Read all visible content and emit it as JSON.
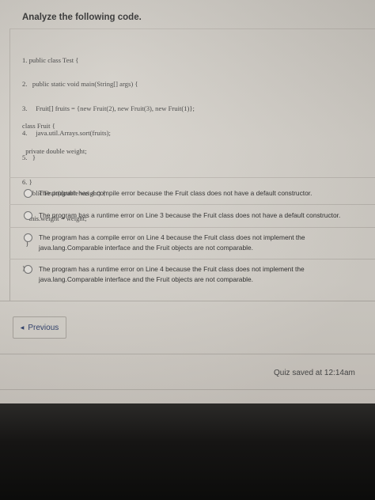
{
  "question": {
    "title": "Analyze the following code.",
    "code_main": [
      "1. public class Test {",
      "2.   public static void main(String[] args) {",
      "3.     Fruit[] fruits = {new Fruit(2), new Fruit(3), new Fruit(1)};",
      "4.     java.util.Arrays.sort(fruits);",
      "5.   }",
      "6. }"
    ],
    "code_class": [
      "class Fruit {",
      "  private double weight;",
      "",
      "  public Fruit(double weight) {",
      "    this.weight = weight;",
      "  }",
      "}"
    ]
  },
  "options": [
    "The program has a compile error because the Fruit class does not have a default constructor.",
    "The program has a runtime error on Line 3 because the Fruit class does not have a default constructor.",
    "The program has a compile error on Line 4 because the Fruit class does not implement the java.lang.Comparable interface and the Fruit objects are not comparable.",
    "The program has a runtime error on Line 4 because the Fruit class does not implement the java.lang.Comparable interface and the Fruit objects are not comparable."
  ],
  "nav": {
    "previous_label": "Previous",
    "previous_icon": "triangle-left-icon"
  },
  "status": {
    "saved_text": "Quiz saved at 12:14am"
  }
}
